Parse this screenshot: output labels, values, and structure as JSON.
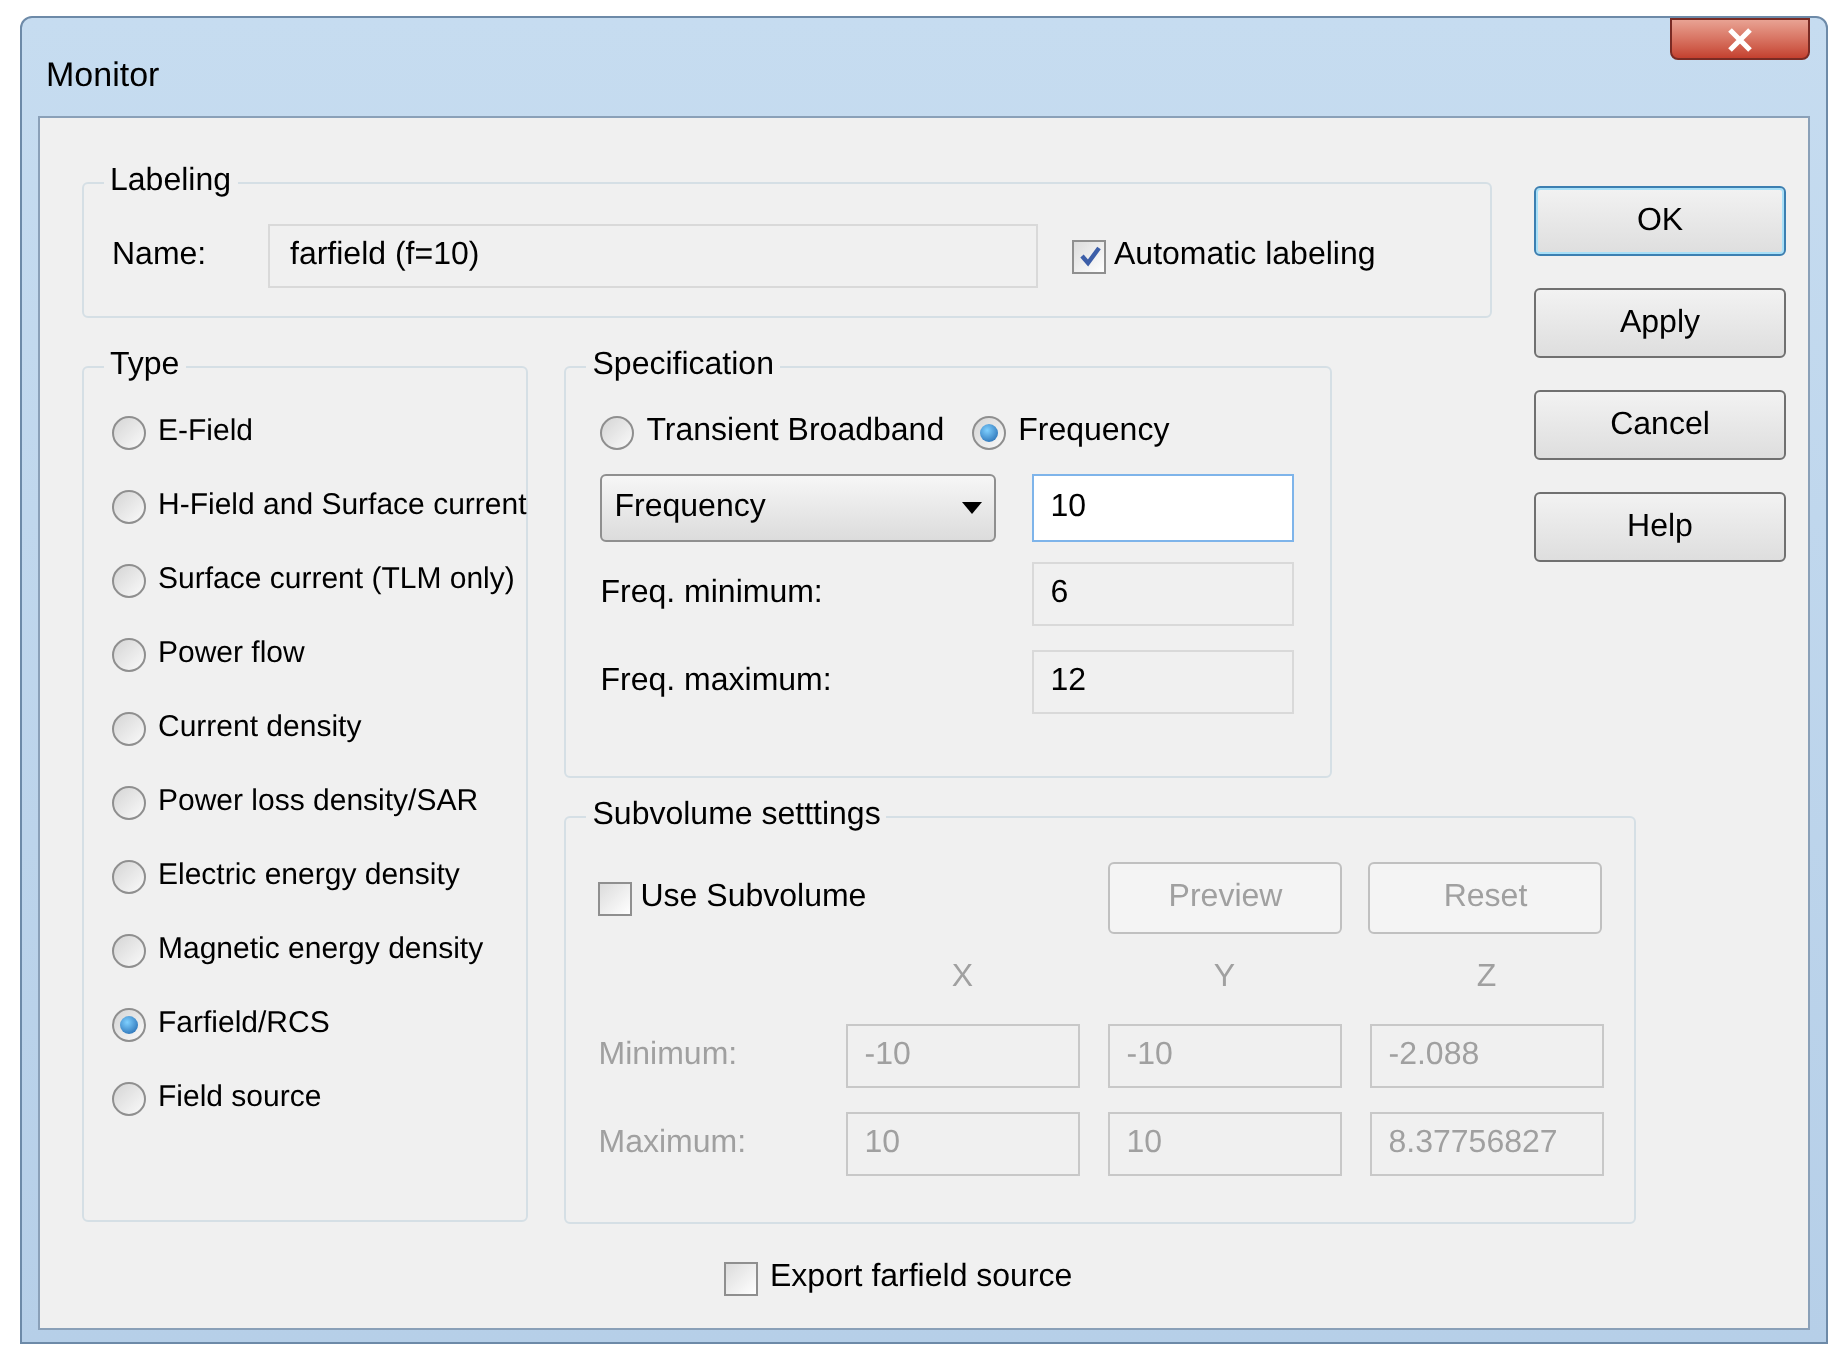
{
  "window": {
    "title": "Monitor"
  },
  "labeling": {
    "title": "Labeling",
    "name_label": "Name:",
    "name_value": "farfield (f=10)",
    "automatic_labeling": {
      "label": "Automatic labeling",
      "checked": true
    }
  },
  "type": {
    "title": "Type",
    "options": [
      {
        "label": "E-Field",
        "selected": false
      },
      {
        "label": "H-Field and Surface current",
        "selected": false
      },
      {
        "label": "Surface current (TLM only)",
        "selected": false
      },
      {
        "label": "Power flow",
        "selected": false
      },
      {
        "label": "Current density",
        "selected": false
      },
      {
        "label": "Power loss density/SAR",
        "selected": false
      },
      {
        "label": "Electric energy density",
        "selected": false
      },
      {
        "label": "Magnetic energy density",
        "selected": false
      },
      {
        "label": "Farfield/RCS",
        "selected": true
      },
      {
        "label": "Field source",
        "selected": false
      }
    ]
  },
  "specification": {
    "title": "Specification",
    "modes": [
      {
        "label": "Transient Broadband",
        "selected": false
      },
      {
        "label": "Frequency",
        "selected": true
      }
    ],
    "dropdown": "Frequency",
    "value": "10",
    "rows": [
      {
        "label": "Freq. minimum:",
        "value": "6"
      },
      {
        "label": "Freq. maximum:",
        "value": "12"
      }
    ]
  },
  "subvolume": {
    "title": "Subvolume setttings",
    "disabled": true,
    "use_subvolume": {
      "label": "Use Subvolume",
      "checked": false
    },
    "buttons": [
      "Preview",
      "Reset"
    ],
    "columns": [
      "X",
      "Y",
      "Z"
    ],
    "rows": [
      {
        "label": "Minimum:",
        "values": [
          "-10",
          "-10",
          "-2.088"
        ]
      },
      {
        "label": "Maximum:",
        "values": [
          "10",
          "10",
          "8.37756827"
        ]
      }
    ]
  },
  "export_farfield_source": {
    "label": "Export farfield source",
    "checked": false
  },
  "buttons": [
    {
      "label": "OK",
      "default": true
    },
    {
      "label": "Apply",
      "default": false
    },
    {
      "label": "Cancel",
      "default": false
    },
    {
      "label": "Help",
      "default": false
    }
  ]
}
